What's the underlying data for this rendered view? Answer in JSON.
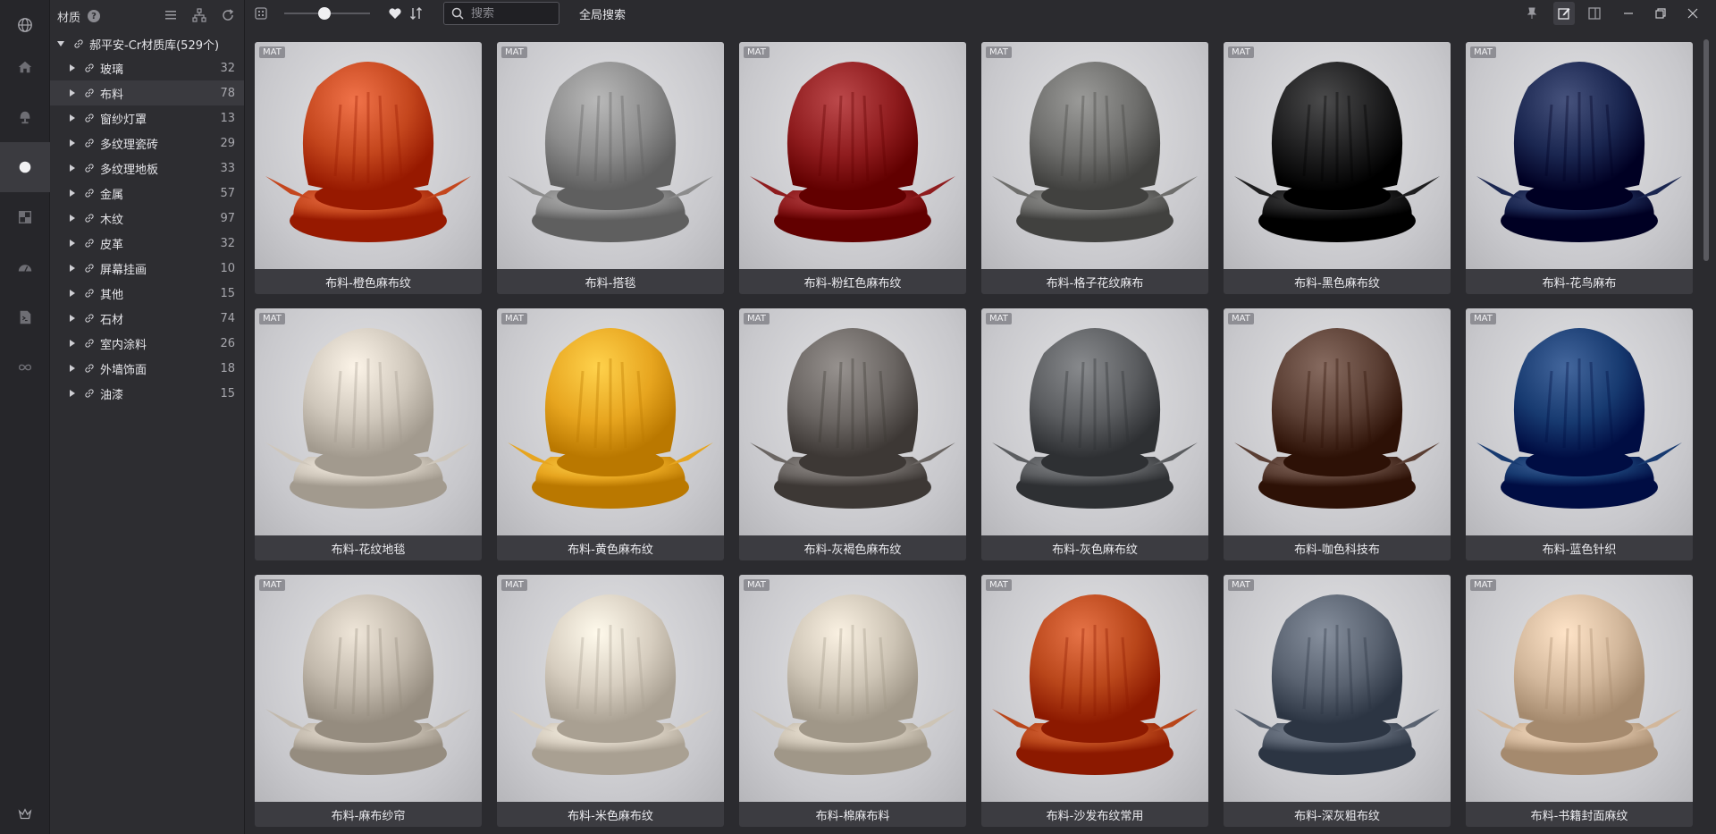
{
  "header": {
    "title": "材质",
    "help": "?"
  },
  "toolbar": {
    "search_placeholder": "搜索",
    "global_search": "全局搜索"
  },
  "tree": {
    "root": "郝平安-Cr材质库(529个)",
    "items": [
      {
        "label": "玻璃",
        "count": "32"
      },
      {
        "label": "布料",
        "count": "78"
      },
      {
        "label": "窗纱灯罩",
        "count": "13"
      },
      {
        "label": "多纹理瓷砖",
        "count": "29"
      },
      {
        "label": "多纹理地板",
        "count": "33"
      },
      {
        "label": "金属",
        "count": "57"
      },
      {
        "label": "木纹",
        "count": "97"
      },
      {
        "label": "皮革",
        "count": "32"
      },
      {
        "label": "屏幕挂画",
        "count": "10"
      },
      {
        "label": "其他",
        "count": "15"
      },
      {
        "label": "石材",
        "count": "74"
      },
      {
        "label": "室内涂料",
        "count": "26"
      },
      {
        "label": "外墙饰面",
        "count": "18"
      },
      {
        "label": "油漆",
        "count": "15"
      }
    ]
  },
  "grid": {
    "badge": "MAT",
    "cards": [
      {
        "label": "布料-橙色麻布纹",
        "color": "#c4461d"
      },
      {
        "label": "布料-搭毯",
        "color": "#8c8c8c"
      },
      {
        "label": "布料-粉红色麻布纹",
        "color": "#8f1c1e"
      },
      {
        "label": "布料-格子花纹麻布",
        "color": "#6e6e6c"
      },
      {
        "label": "布料-黑色麻布纹",
        "color": "#1e1e1f"
      },
      {
        "label": "布料-花鸟麻布",
        "color": "#1a2650"
      },
      {
        "label": "布料-花纹地毯",
        "color": "#cfc7bb"
      },
      {
        "label": "布料-黄色麻布纹",
        "color": "#e7a51f"
      },
      {
        "label": "布料-灰褐色麻布纹",
        "color": "#6a6562"
      },
      {
        "label": "布料-灰色麻布纹",
        "color": "#5b5d60"
      },
      {
        "label": "布料-咖色科技布",
        "color": "#5a3e33"
      },
      {
        "label": "布料-蓝色针织",
        "color": "#173a70"
      },
      {
        "label": "布料-麻布纱帘",
        "color": "#c2b9ac"
      },
      {
        "label": "布料-米色麻布纹",
        "color": "#d6cdbf"
      },
      {
        "label": "布料-棉麻布料",
        "color": "#cdc4b5"
      },
      {
        "label": "布料-沙发布纹常用",
        "color": "#b9461a"
      },
      {
        "label": "布料-深灰粗布纹",
        "color": "#596270"
      },
      {
        "label": "布料-书籍封面麻纹",
        "color": "#d2b79b"
      }
    ]
  }
}
